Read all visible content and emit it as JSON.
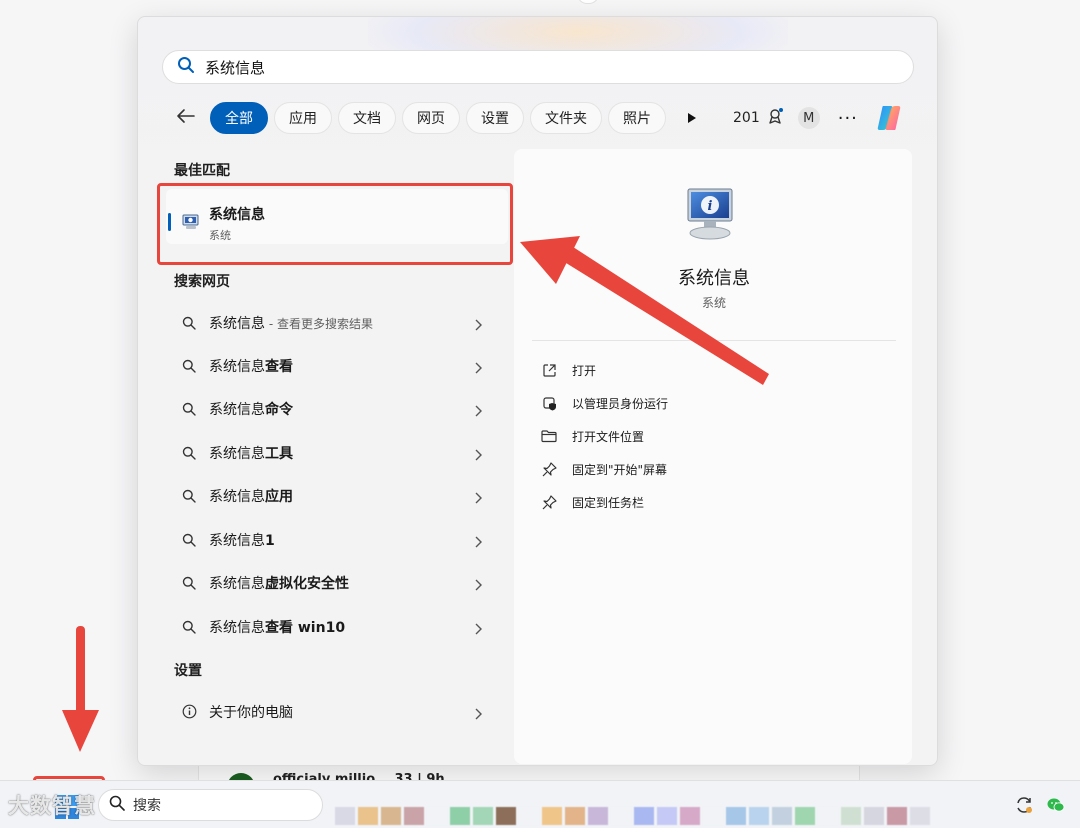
{
  "search": {
    "value": "系统信息"
  },
  "filters": {
    "tabs": [
      {
        "label": "全部",
        "active": true
      },
      {
        "label": "应用"
      },
      {
        "label": "文档"
      },
      {
        "label": "网页"
      },
      {
        "label": "设置"
      },
      {
        "label": "文件夹"
      },
      {
        "label": "照片"
      }
    ],
    "points": "201",
    "avatar_initial": "M",
    "more": "···"
  },
  "best_match": {
    "section_title": "最佳匹配",
    "title": "系统信息",
    "subtitle": "系统"
  },
  "web_search": {
    "section_title": "搜索网页",
    "items": [
      {
        "prefix": "系统信息",
        "bold": "",
        "suffix": " - 查看更多搜索结果"
      },
      {
        "prefix": "系统信息",
        "bold": "查看",
        "suffix": ""
      },
      {
        "prefix": "系统信息",
        "bold": "命令",
        "suffix": ""
      },
      {
        "prefix": "系统信息",
        "bold": "工具",
        "suffix": ""
      },
      {
        "prefix": "系统信息",
        "bold": "应用",
        "suffix": ""
      },
      {
        "prefix": "系统信息",
        "bold": "1",
        "suffix": ""
      },
      {
        "prefix": "系统信息",
        "bold": "虚拟化安全性",
        "suffix": ""
      },
      {
        "prefix": "系统信息",
        "bold": "查看 win10",
        "suffix": ""
      }
    ]
  },
  "settings": {
    "section_title": "设置",
    "items": [
      {
        "label": "关于你的电脑"
      }
    ]
  },
  "preview": {
    "title": "系统信息",
    "subtitle": "系统",
    "actions": [
      {
        "label": "打开",
        "icon": "open-external-icon"
      },
      {
        "label": "以管理员身份运行",
        "icon": "shield-icon"
      },
      {
        "label": "打开文件位置",
        "icon": "folder-icon"
      },
      {
        "label": "固定到\"开始\"屏幕",
        "icon": "pin-icon"
      },
      {
        "label": "固定到任务栏",
        "icon": "pin-icon"
      }
    ]
  },
  "taskbar": {
    "search_label": "搜索",
    "background_item_text": "officialy millio... 33 | 9h"
  },
  "watermark": "大数智慧",
  "colors": {
    "accent": "#005fb8",
    "annotation_red": "#e8453c"
  }
}
